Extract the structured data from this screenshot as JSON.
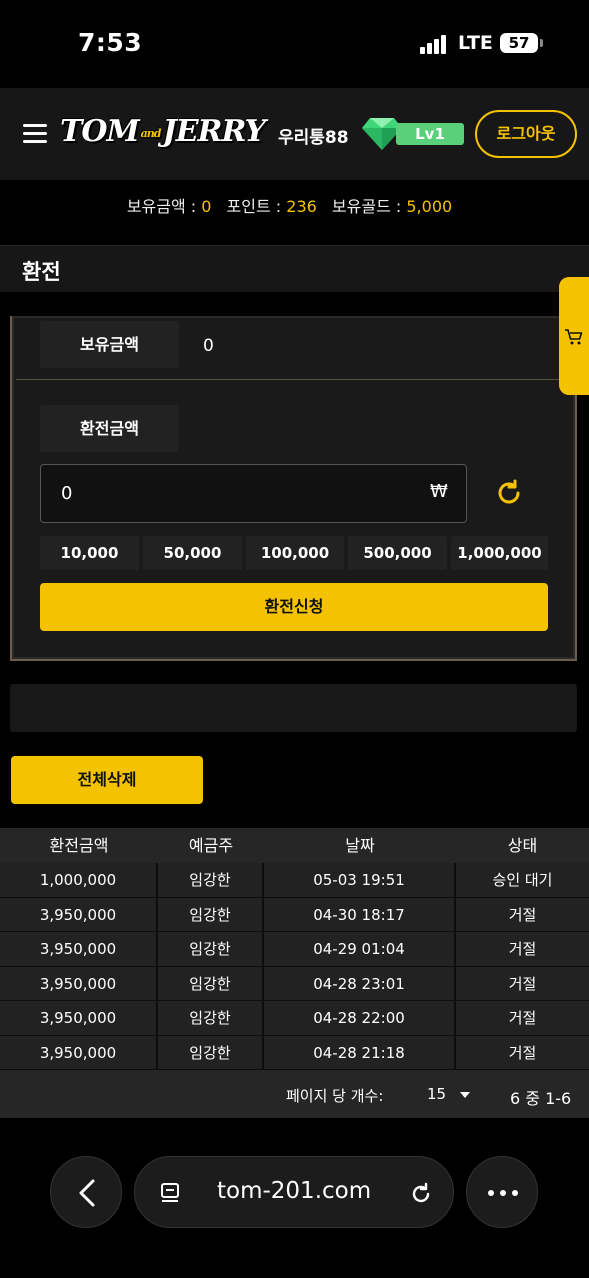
{
  "status": {
    "time": "7:53",
    "network": "LTE",
    "battery": "57"
  },
  "header": {
    "logo_left": "TOM",
    "logo_and": "and",
    "logo_right": "JERRY",
    "username": "우리퉁88",
    "level": "Lv1",
    "logout_label": "로그아웃"
  },
  "balance": {
    "holding_label": "보유금액 : ",
    "holding_value": "0",
    "point_label": "포인트 : ",
    "point_value": "236",
    "gold_label": "보유골드 : ",
    "gold_value": "5,000"
  },
  "page_title": "환전",
  "form": {
    "holding_label": "보유금액",
    "holding_value": "0",
    "exchange_label": "환전금액",
    "amount_value": "0",
    "currency_symbol": "₩",
    "quick_amounts": [
      "10,000",
      "50,000",
      "100,000",
      "500,000",
      "1,000,000"
    ],
    "submit_label": "환전신청"
  },
  "delete_all_label": "전체삭제",
  "table": {
    "headers": [
      "환전금액",
      "예금주",
      "날짜",
      "상태"
    ],
    "rows": [
      [
        "1,000,000",
        "임강한",
        "05-03 19:51",
        "승인 대기"
      ],
      [
        "3,950,000",
        "임강한",
        "04-30 18:17",
        "거절"
      ],
      [
        "3,950,000",
        "임강한",
        "04-29 01:04",
        "거절"
      ],
      [
        "3,950,000",
        "임강한",
        "04-28 23:01",
        "거절"
      ],
      [
        "3,950,000",
        "임강한",
        "04-28 22:00",
        "거절"
      ],
      [
        "3,950,000",
        "임강한",
        "04-28 21:18",
        "거절"
      ]
    ]
  },
  "pagination": {
    "per_page_label": "페이지 당 개수:",
    "per_page_value": "15",
    "range": "6 중 1-6"
  },
  "browser": {
    "url": "tom-201.com"
  },
  "colors": {
    "accent": "#f5c200",
    "level_green": "#5ad07a",
    "background": "#000000"
  }
}
